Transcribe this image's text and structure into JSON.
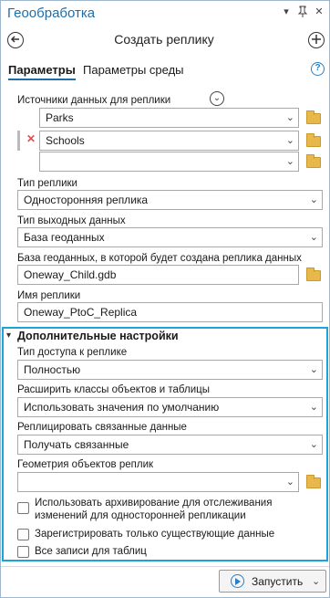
{
  "window": {
    "title": "Геообработка",
    "controls": [
      "chevron-down-icon",
      "pin-icon",
      "close-icon"
    ]
  },
  "nav": {
    "title": "Создать реплику",
    "back_icon": "back-arrow-icon",
    "add_icon": "plus-icon"
  },
  "tabs": [
    {
      "label": "Параметры",
      "active": true
    },
    {
      "label": "Параметры среды",
      "active": false
    }
  ],
  "params": {
    "sources_label": "Источники данных для реплики",
    "sources": [
      "Parks",
      "Schools",
      ""
    ],
    "replica_type_label": "Тип реплики",
    "replica_type_value": "Односторонняя реплика",
    "output_type_label": "Тип выходных данных",
    "output_type_value": "База геоданных",
    "gdb_label": "База геоданных, в которой будет создана реплика данных",
    "gdb_value": "Oneway_Child.gdb",
    "name_label": "Имя реплики",
    "name_value": "Oneway_PtoC_Replica"
  },
  "advanced": {
    "header": "Дополнительные настройки",
    "access_label": "Тип доступа к реплике",
    "access_value": "Полностью",
    "expand_label": "Расширить классы объектов и таблицы",
    "expand_value": "Использовать значения по умолчанию",
    "related_label": "Реплицировать связанные данные",
    "related_value": "Получать связанные",
    "geometry_label": "Геометрия объектов реплик",
    "geometry_value": "",
    "checkboxes": [
      {
        "line1": "Использовать архивирование для отслеживания",
        "line2": "изменений для односторонней репликации",
        "checked": false
      },
      {
        "line1": "Зарегистрировать только существующие данные",
        "checked": false
      },
      {
        "line1": "Все записи для таблиц",
        "checked": false
      }
    ]
  },
  "footer": {
    "run_label": "Запустить"
  },
  "colors": {
    "accent": "#1f6ea8",
    "highlight_border": "#19a5d8",
    "remove_x": "#d9534f",
    "folder": "#e8b84a"
  }
}
